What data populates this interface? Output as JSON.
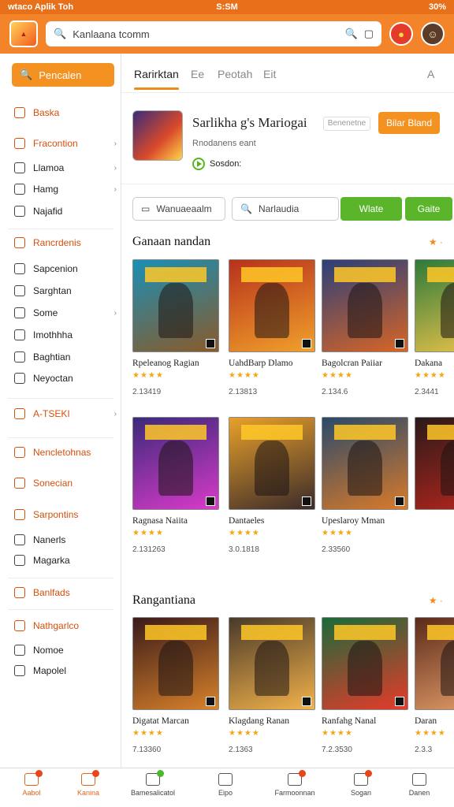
{
  "status": {
    "left": "wtaco Aplik Toh",
    "center": "S:SM",
    "right": "30%"
  },
  "search": {
    "placeholder": "Kanlaana tcomm"
  },
  "sidebar": {
    "button": "Pencalen",
    "items": [
      {
        "label": "Baska",
        "orange": true
      },
      {
        "label": "Fracontion",
        "orange": true,
        "arrow": true
      },
      {
        "label": "Llamoa",
        "arrow": true
      },
      {
        "label": "Hamg",
        "arrow": true
      },
      {
        "label": "Najafid"
      },
      {
        "label": "Rancrdenis",
        "orange": true
      },
      {
        "label": "Sapcenion"
      },
      {
        "label": "Sarghtan"
      },
      {
        "label": "Some",
        "arrow": true
      },
      {
        "label": "Imothhha"
      },
      {
        "label": "Baghtian"
      },
      {
        "label": "Neyoctan"
      },
      {
        "label": "A-TSEKI",
        "orange": true,
        "arrow": true
      },
      {
        "label": "Nencletohnas",
        "orange": true
      },
      {
        "label": "Sonecian",
        "orange": true
      },
      {
        "label": "Sarpontins",
        "orange": true
      },
      {
        "label": "Nanerls"
      },
      {
        "label": "Magarka"
      },
      {
        "label": "Banlfads",
        "orange": true
      },
      {
        "label": "Nathgarlco",
        "orange": true
      },
      {
        "label": "Nomoe"
      },
      {
        "label": "Mapolel"
      }
    ]
  },
  "tabs": [
    "Rarirktan",
    "Ee",
    "Peotah",
    "Eit",
    "A"
  ],
  "featured": {
    "title": "Sarlikha g's Mariogai",
    "tag": "Benenetne",
    "subtitle": "Rnodanens eant",
    "play": "Sosdon:",
    "button": "Bilar Bland"
  },
  "filters": {
    "input1": "Wanuaeaalm",
    "input2": "Narlaudia",
    "btn1": "Wlate",
    "btn2": "Gaite"
  },
  "section1": {
    "title": "Ganaan nandan",
    "more": "★ ·",
    "cards": [
      {
        "name": "Rpeleanog Ragian",
        "stars": "★★★★",
        "num": "2.13419",
        "c1": "#1a8fb5",
        "c2": "#8a5a2a"
      },
      {
        "name": "UahdBarp Dlamo",
        "stars": "★★★★",
        "num": "2.13813",
        "c1": "#b8311c",
        "c2": "#f1a12b"
      },
      {
        "name": "Bagolcran Paiiar",
        "stars": "★★★★",
        "num": "2.134.6",
        "c1": "#2b3f7a",
        "c2": "#d86525"
      },
      {
        "name": "Dakana",
        "stars": "★★★★",
        "num": "2.3441",
        "c1": "#2c7a3a",
        "c2": "#f2c64a"
      }
    ]
  },
  "section2": {
    "cards": [
      {
        "name": "Ragnasa Naiita",
        "stars": "★★★★",
        "num": "2.131263",
        "c1": "#3a2a7a",
        "c2": "#d93ac9"
      },
      {
        "name": "Dantaeles",
        "stars": "★★★★",
        "num": "3.0.1818",
        "c1": "#e8a02a",
        "c2": "#3b2b2a"
      },
      {
        "name": "Upeslaroy Mman",
        "stars": "★★★★",
        "num": "2.33560",
        "c1": "#2a4a6a",
        "c2": "#d97a2a"
      },
      {
        "name": "",
        "stars": "",
        "num": "",
        "c1": "#2a1a1a",
        "c2": "#b8261c"
      }
    ]
  },
  "section3": {
    "title": "Rangantiana",
    "more": "★ ·",
    "cards": [
      {
        "name": "Digatat Marcan",
        "stars": "★★★★",
        "num": "7.13360",
        "c1": "#3a1a1a",
        "c2": "#d8822a"
      },
      {
        "name": "Klagdang Ranan",
        "stars": "★★★★",
        "num": "2.1363",
        "c1": "#4a3a2a",
        "c2": "#f2b24a"
      },
      {
        "name": "Ranfahg Nanal",
        "stars": "★★★★",
        "num": "7.2.3530",
        "c1": "#1a6a3a",
        "c2": "#e83a2a"
      },
      {
        "name": "Daran",
        "stars": "★★★★",
        "num": "2.3.3",
        "c1": "#5a2a1a",
        "c2": "#e8a06a"
      }
    ]
  },
  "bottom": [
    {
      "label": "Aabol",
      "active": true,
      "dot": "red"
    },
    {
      "label": "Kanina",
      "active": true,
      "dot": "red"
    },
    {
      "label": "Bamesalicatol",
      "dot": "green"
    },
    {
      "label": "Eipo"
    },
    {
      "label": "Farmoonnan",
      "dot": "red"
    },
    {
      "label": "Sogan",
      "dot": "red"
    },
    {
      "label": "Danen"
    }
  ]
}
